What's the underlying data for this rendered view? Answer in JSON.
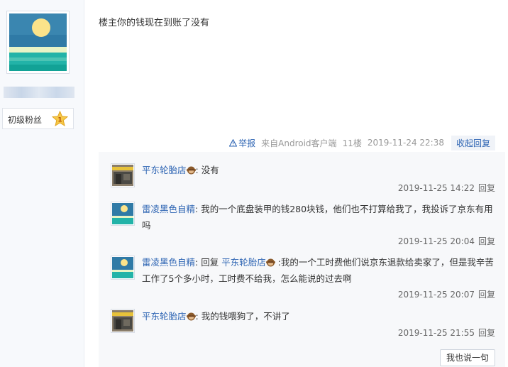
{
  "user": {
    "rank_label": "初级粉丝",
    "rank_level": "1",
    "avatar_icon": "moon-sea-avatar-icon"
  },
  "post": {
    "content": "楼主你的钱现在到账了没有",
    "meta": {
      "report_label": "举报",
      "source": "来自Android客户端",
      "floor": "11楼",
      "time": "2019-11-24 22:38",
      "collapse_label": "收起回复"
    }
  },
  "replies": [
    {
      "author": "平东轮胎店",
      "separator": ": ",
      "text": "没有",
      "time": "2019-11-25 14:22",
      "reply_label": "回复",
      "avatar_icon": "shop-avatar-icon"
    },
    {
      "author": "雷凌黑色自精",
      "separator": ": ",
      "text": "我的一个底盘装甲的钱280块钱，他们也不打算给我了，我投诉了京东有用吗",
      "time": "2019-11-25 20:04",
      "reply_label": "回复",
      "avatar_icon": "moon-sea-avatar-icon"
    },
    {
      "author": "雷凌黑色自精",
      "separator": ": ",
      "prefix": "回复 ",
      "target": "平东轮胎店",
      "text": " :我的一个工时费他们说京东退款给卖家了，但是我辛苦工作了5个多小时，工时费不给我，怎么能说的过去啊",
      "time": "2019-11-25 20:07",
      "reply_label": "回复",
      "avatar_icon": "moon-sea-avatar-icon"
    },
    {
      "author": "平东轮胎店",
      "separator": ": ",
      "text": "我的钱喂狗了，不讲了",
      "time": "2019-11-25 21:55",
      "reply_label": "回复",
      "avatar_icon": "shop-avatar-icon"
    }
  ],
  "say_button_label": "我也说一句",
  "colors": {
    "link": "#2d64b3",
    "reply_bg": "#f7f8fa",
    "left_bg": "#f7f9fc"
  }
}
